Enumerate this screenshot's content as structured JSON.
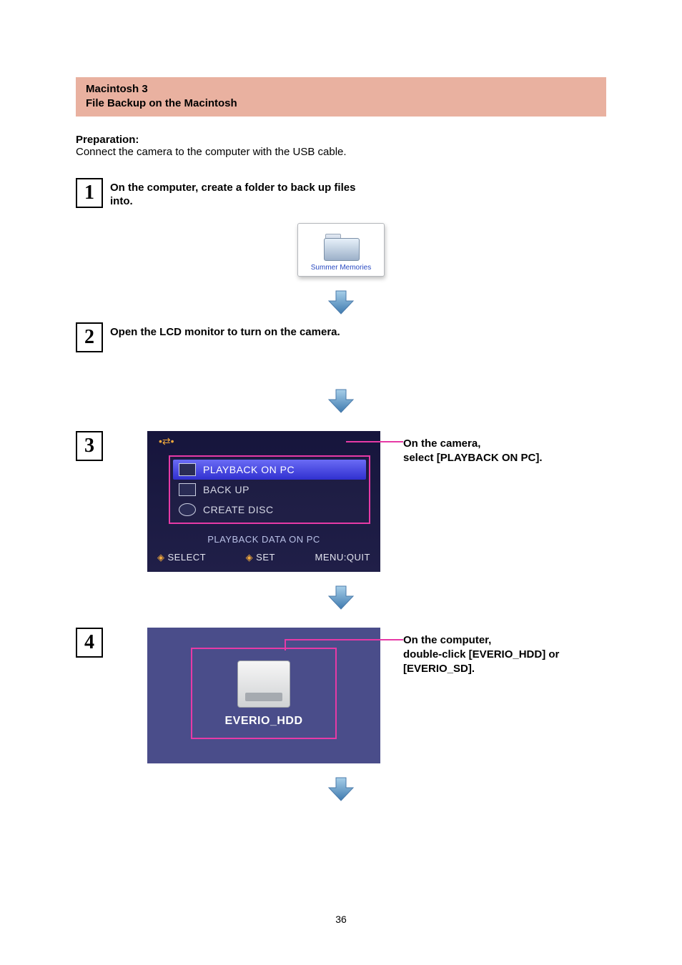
{
  "banner": {
    "line1": "Macintosh 3",
    "line2": "File Backup on the Macintosh"
  },
  "preparation": {
    "title": "Preparation:",
    "text": "Connect the camera to the computer with the USB cable."
  },
  "steps": {
    "s1": {
      "num": "1",
      "text": "On the computer, create a folder to back up files into."
    },
    "s2": {
      "num": "2",
      "text": "Open the LCD monitor to turn on the camera."
    },
    "s3": {
      "num": "3",
      "note": "On the camera,\nselect [PLAYBACK ON PC]."
    },
    "s4": {
      "num": "4",
      "note": "On the computer,\ndouble-click [EVERIO_HDD] or [EVERIO_SD]."
    }
  },
  "folder": {
    "label": "Summer Memories"
  },
  "camera_menu": {
    "items": [
      {
        "label": "PLAYBACK ON PC",
        "selected": true,
        "icon": "screen"
      },
      {
        "label": "BACK UP",
        "selected": false,
        "icon": "screen"
      },
      {
        "label": "CREATE DISC",
        "selected": false,
        "icon": "disc"
      }
    ],
    "desc": "PLAYBACK DATA ON PC",
    "bottom": {
      "select": "SELECT",
      "set": "SET",
      "quit": "MENU:QUIT"
    },
    "usb_glyph": "•⇄•"
  },
  "drive": {
    "label": "EVERIO_HDD"
  },
  "page_number": "36"
}
